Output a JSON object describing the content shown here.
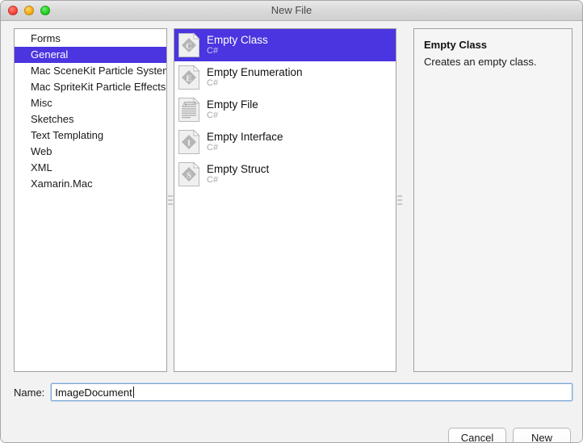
{
  "window": {
    "title": "New File",
    "traffic_lights": [
      "close",
      "minimize",
      "maximize"
    ]
  },
  "colors": {
    "selection_blue": "#4a35e0",
    "selection_text": "#ffffff",
    "panel_background": "#ffffff",
    "window_chrome": "#f2f2f2",
    "focus_border": "#7ba7d7",
    "subtitle_gray": "#a8a8a8"
  },
  "categories": {
    "selected_index": 1,
    "items": [
      {
        "label": "Forms"
      },
      {
        "label": "General"
      },
      {
        "label": "Mac SceneKit Particle System"
      },
      {
        "label": "Mac SpriteKit Particle Effects"
      },
      {
        "label": "Misc"
      },
      {
        "label": "Sketches"
      },
      {
        "label": "Text Templating"
      },
      {
        "label": "Web"
      },
      {
        "label": "XML"
      },
      {
        "label": "Xamarin.Mac"
      }
    ]
  },
  "templates": {
    "selected_index": 0,
    "items": [
      {
        "title": "Empty Class",
        "language": "C#",
        "icon": "document-class-icon",
        "glyph": "C",
        "icon_shape": "diamond"
      },
      {
        "title": "Empty Enumeration",
        "language": "C#",
        "icon": "document-enum-icon",
        "glyph": "E",
        "icon_shape": "diamond"
      },
      {
        "title": "Empty File",
        "language": "C#",
        "icon": "document-text-lines-icon",
        "glyph": "A",
        "icon_shape": "lines"
      },
      {
        "title": "Empty Interface",
        "language": "C#",
        "icon": "document-interface-icon",
        "glyph": "I",
        "icon_shape": "diamond"
      },
      {
        "title": "Empty Struct",
        "language": "C#",
        "icon": "document-struct-icon",
        "glyph": "S",
        "icon_shape": "diamond"
      }
    ]
  },
  "description": {
    "title": "Empty Class",
    "body": "Creates an empty class."
  },
  "name_field": {
    "label": "Name:",
    "value": "ImageDocument",
    "placeholder": ""
  },
  "footer": {
    "cancel_label": "Cancel",
    "new_label": "New"
  },
  "splitters": [
    {
      "name": "left-splitter",
      "grip": "resize-grip-icon"
    },
    {
      "name": "right-splitter",
      "grip": "resize-grip-icon"
    }
  ]
}
